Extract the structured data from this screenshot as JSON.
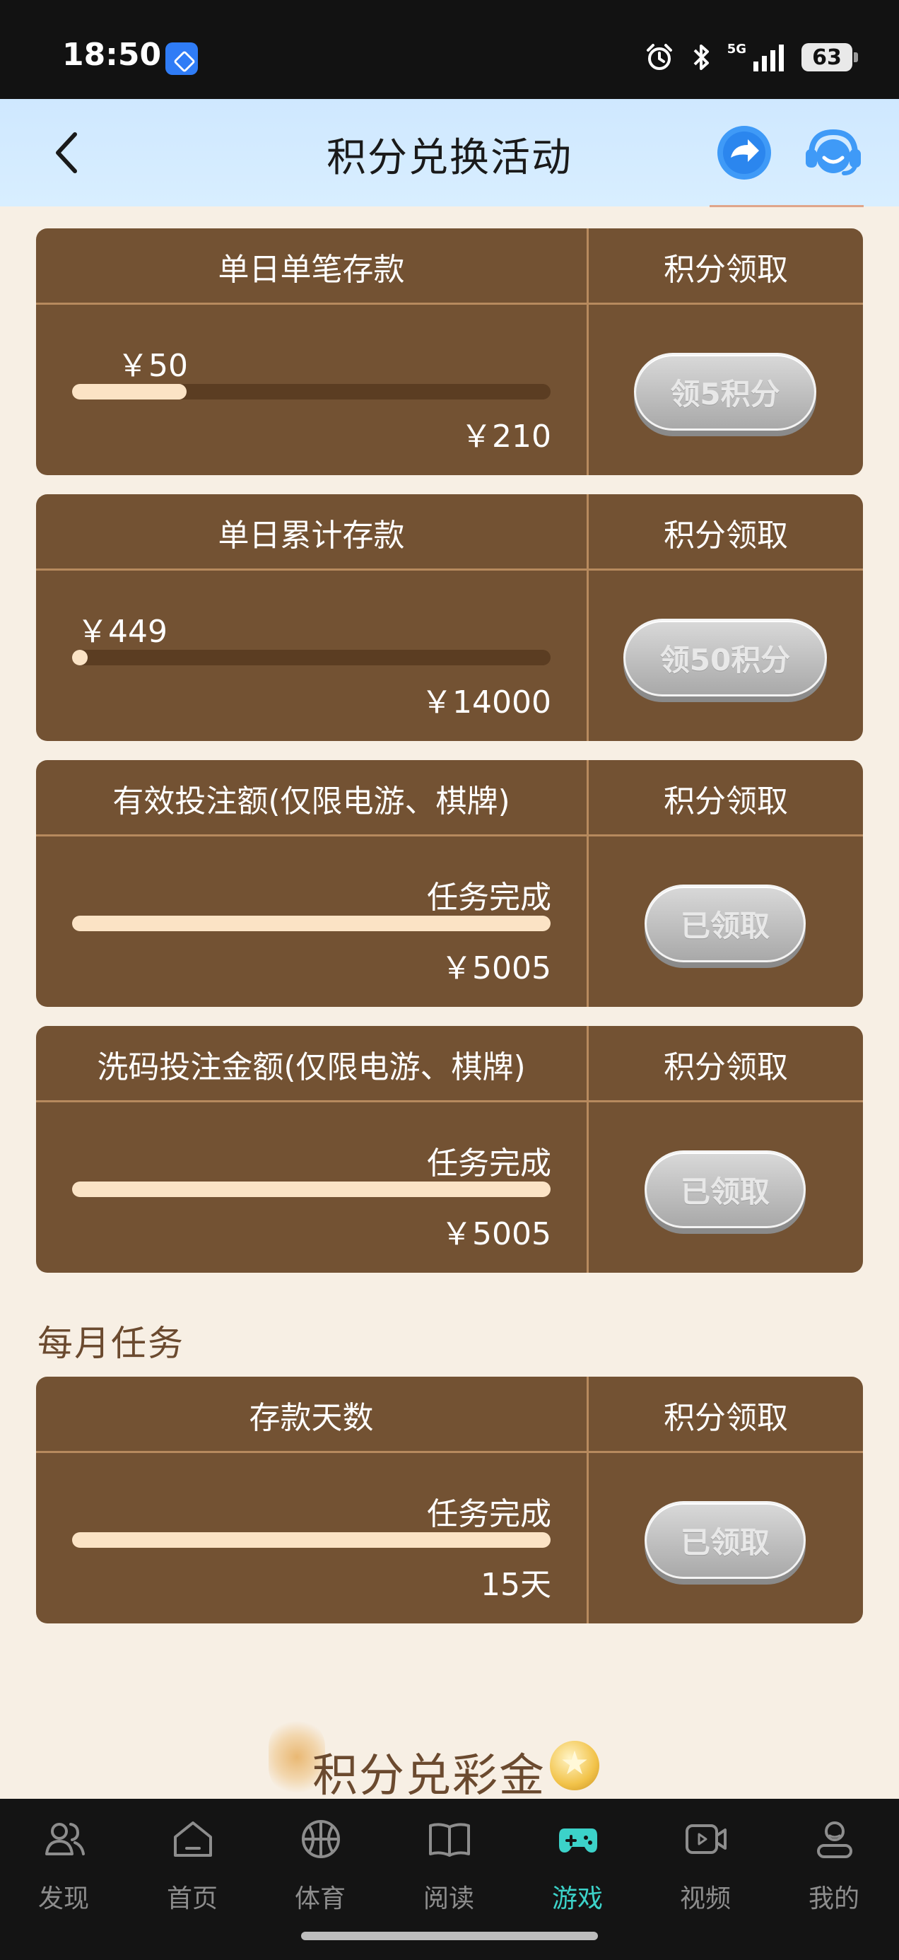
{
  "status_bar": {
    "time": "18:50",
    "network": "5G",
    "battery": "63"
  },
  "nav": {
    "title": "积分兑换活动"
  },
  "tasks": [
    {
      "title": "单日单笔存款",
      "column": "积分领取",
      "progress_label": "￥50",
      "progress": 0.24,
      "target": "￥210",
      "button": "领5积分"
    },
    {
      "title": "单日累计存款",
      "column": "积分领取",
      "progress_label": "￥449",
      "progress": 0.032,
      "target": "￥14000",
      "button": "领50积分"
    },
    {
      "title": "有效投注额(仅限电游、棋牌)",
      "column": "积分领取",
      "progress_label": "任务完成",
      "progress": 1,
      "target": "￥5005",
      "button": "已领取"
    },
    {
      "title": "洗码投注金额(仅限电游、棋牌)",
      "column": "积分领取",
      "progress_label": "任务完成",
      "progress": 1,
      "target": "￥5005",
      "button": "已领取"
    }
  ],
  "monthly": {
    "section_title": "每月任务",
    "task": {
      "title": "存款天数",
      "column": "积分领取",
      "progress_label": "任务完成",
      "progress": 1,
      "target": "15天",
      "button": "已领取"
    }
  },
  "banner": {
    "text": "积分兑彩金"
  },
  "bottom_nav": {
    "items": [
      {
        "label": "发现",
        "icon": "users-icon"
      },
      {
        "label": "首页",
        "icon": "home-icon"
      },
      {
        "label": "体育",
        "icon": "basketball-icon"
      },
      {
        "label": "阅读",
        "icon": "book-icon"
      },
      {
        "label": "游戏",
        "icon": "gamepad-icon",
        "active": true
      },
      {
        "label": "视频",
        "icon": "video-icon"
      },
      {
        "label": "我的",
        "icon": "profile-icon"
      }
    ]
  },
  "colors": {
    "card_bg": "#735233",
    "divider": "#b78a5e",
    "progress_fill": "#fbe3c5",
    "active_tab": "#3cd2c9",
    "page_bg": "#f7efe4"
  }
}
